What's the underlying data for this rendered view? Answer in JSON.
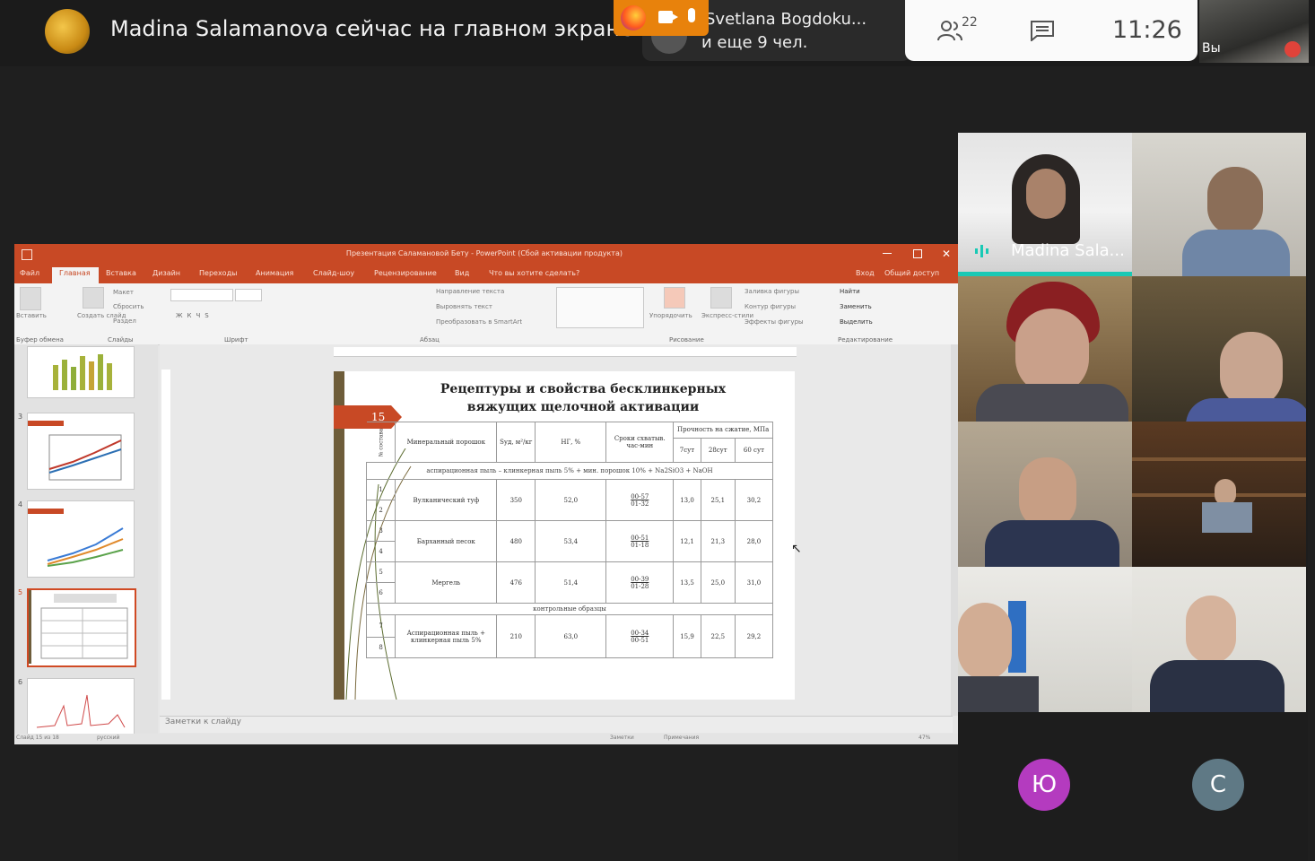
{
  "top_bar": {
    "presenter_banner": "Madina Salamanova сейчас на главном экране",
    "others_line1": "Svetlana Bogdoku...",
    "others_line2": "и еще 9 чел.",
    "participants_count": "22",
    "time": "11:26",
    "self_label": "Вы"
  },
  "icons": [
    "firefox-icon",
    "camera-icon",
    "mic-icon",
    "people-icon",
    "chat-icon",
    "mic-off-icon",
    "close-icon",
    "maximize-icon",
    "minimize-icon",
    "save-icon",
    "speaking-icon"
  ],
  "powerpoint": {
    "window_title": "Презентация Саламановой Бету - PowerPoint (Сбой активации продукта)",
    "tabs": [
      "Файл",
      "Главная",
      "Вставка",
      "Дизайн",
      "Переходы",
      "Анимация",
      "Слайд-шоу",
      "Рецензирование",
      "Вид",
      "Что вы хотите сделать?"
    ],
    "right_tabs": [
      "Вход",
      "Общий доступ"
    ],
    "ribbon_groups": [
      "Буфер обмена",
      "Слайды",
      "Шрифт",
      "Абзац",
      "Рисование",
      "Редактирование"
    ],
    "ribbon_items": {
      "paste": "Вставить",
      "new_slide": "Создать слайд",
      "layout": "Макет",
      "reset": "Сбросить",
      "section": "Раздел",
      "text_direction": "Направление текста",
      "align_text": "Выровнять текст",
      "smartart": "Преобразовать в SmartArt",
      "arrange": "Упорядочить",
      "quick_styles": "Экспресс-стили",
      "shape_fill": "Заливка фигуры",
      "shape_outline": "Контур фигуры",
      "shape_effects": "Эффекты фигуры",
      "find": "Найти",
      "replace": "Заменить",
      "select": "Выделить"
    },
    "thumb_numbers": [
      "3",
      "4",
      "5",
      "6"
    ],
    "notes_placeholder": "Заметки к слайду",
    "status_left": "Слайд 15 из 18",
    "status_lang": "русский",
    "status_notes": "Заметки",
    "status_comments": "Примечания",
    "zoom": "47%"
  },
  "slide": {
    "number": "15",
    "title_line1": "Рецептуры и свойства бесклинкерных",
    "title_line2": "вяжущих щелочной активации",
    "table": {
      "col_no": "№ состава",
      "col_mineral": "Минеральный порошок",
      "col_s": "Sуд, м²/кг",
      "col_nw": "НГ, %",
      "col_setting": "Сроки схватыв. час-мин",
      "col_strength": "Прочность на сжатие, МПа",
      "col_7d": "7сут",
      "col_28d": "28сут",
      "col_60d": "60 сут",
      "section1": "аспирационная пыль – клинкерная пыль 5% + мин. порошок 10% + Na2SiO3 + NaOH",
      "section2": "контрольные образцы",
      "rows": [
        {
          "nos": [
            "1",
            "2"
          ],
          "mineral": "Вулканический туф",
          "s": "350",
          "nw": "52,0",
          "setting_top": "00-57",
          "setting_bottom": "01-32",
          "d7": "13,0",
          "d28": "25,1",
          "d60": "30,2"
        },
        {
          "nos": [
            "3",
            "4"
          ],
          "mineral": "Барханный песок",
          "s": "480",
          "nw": "53,4",
          "setting_top": "00-51",
          "setting_bottom": "01-18",
          "d7": "12,1",
          "d28": "21,3",
          "d60": "28,0"
        },
        {
          "nos": [
            "5",
            "6"
          ],
          "mineral": "Мергель",
          "s": "476",
          "nw": "51,4",
          "setting_top": "00-39",
          "setting_bottom": "01-28",
          "d7": "13,5",
          "d28": "25,0",
          "d60": "31,0"
        },
        {
          "nos": [
            "7",
            "8"
          ],
          "mineral": "Аспирационная пыль + клинкерная пыль 5%",
          "s": "210",
          "nw": "63,0",
          "setting_top": "00-34",
          "setting_bottom": "00-51",
          "d7": "15,9",
          "d28": "22,5",
          "d60": "29,2"
        }
      ]
    }
  },
  "video_grid": {
    "active_speaker_name": "Madina Sala...",
    "avatar_letters": [
      "Ю",
      "С"
    ],
    "colors": {
      "accent_teal": "#19c9b5",
      "avatar_purple": "#b43bbf",
      "avatar_slate": "#5f7985",
      "ppt_orange": "#c84925"
    }
  }
}
